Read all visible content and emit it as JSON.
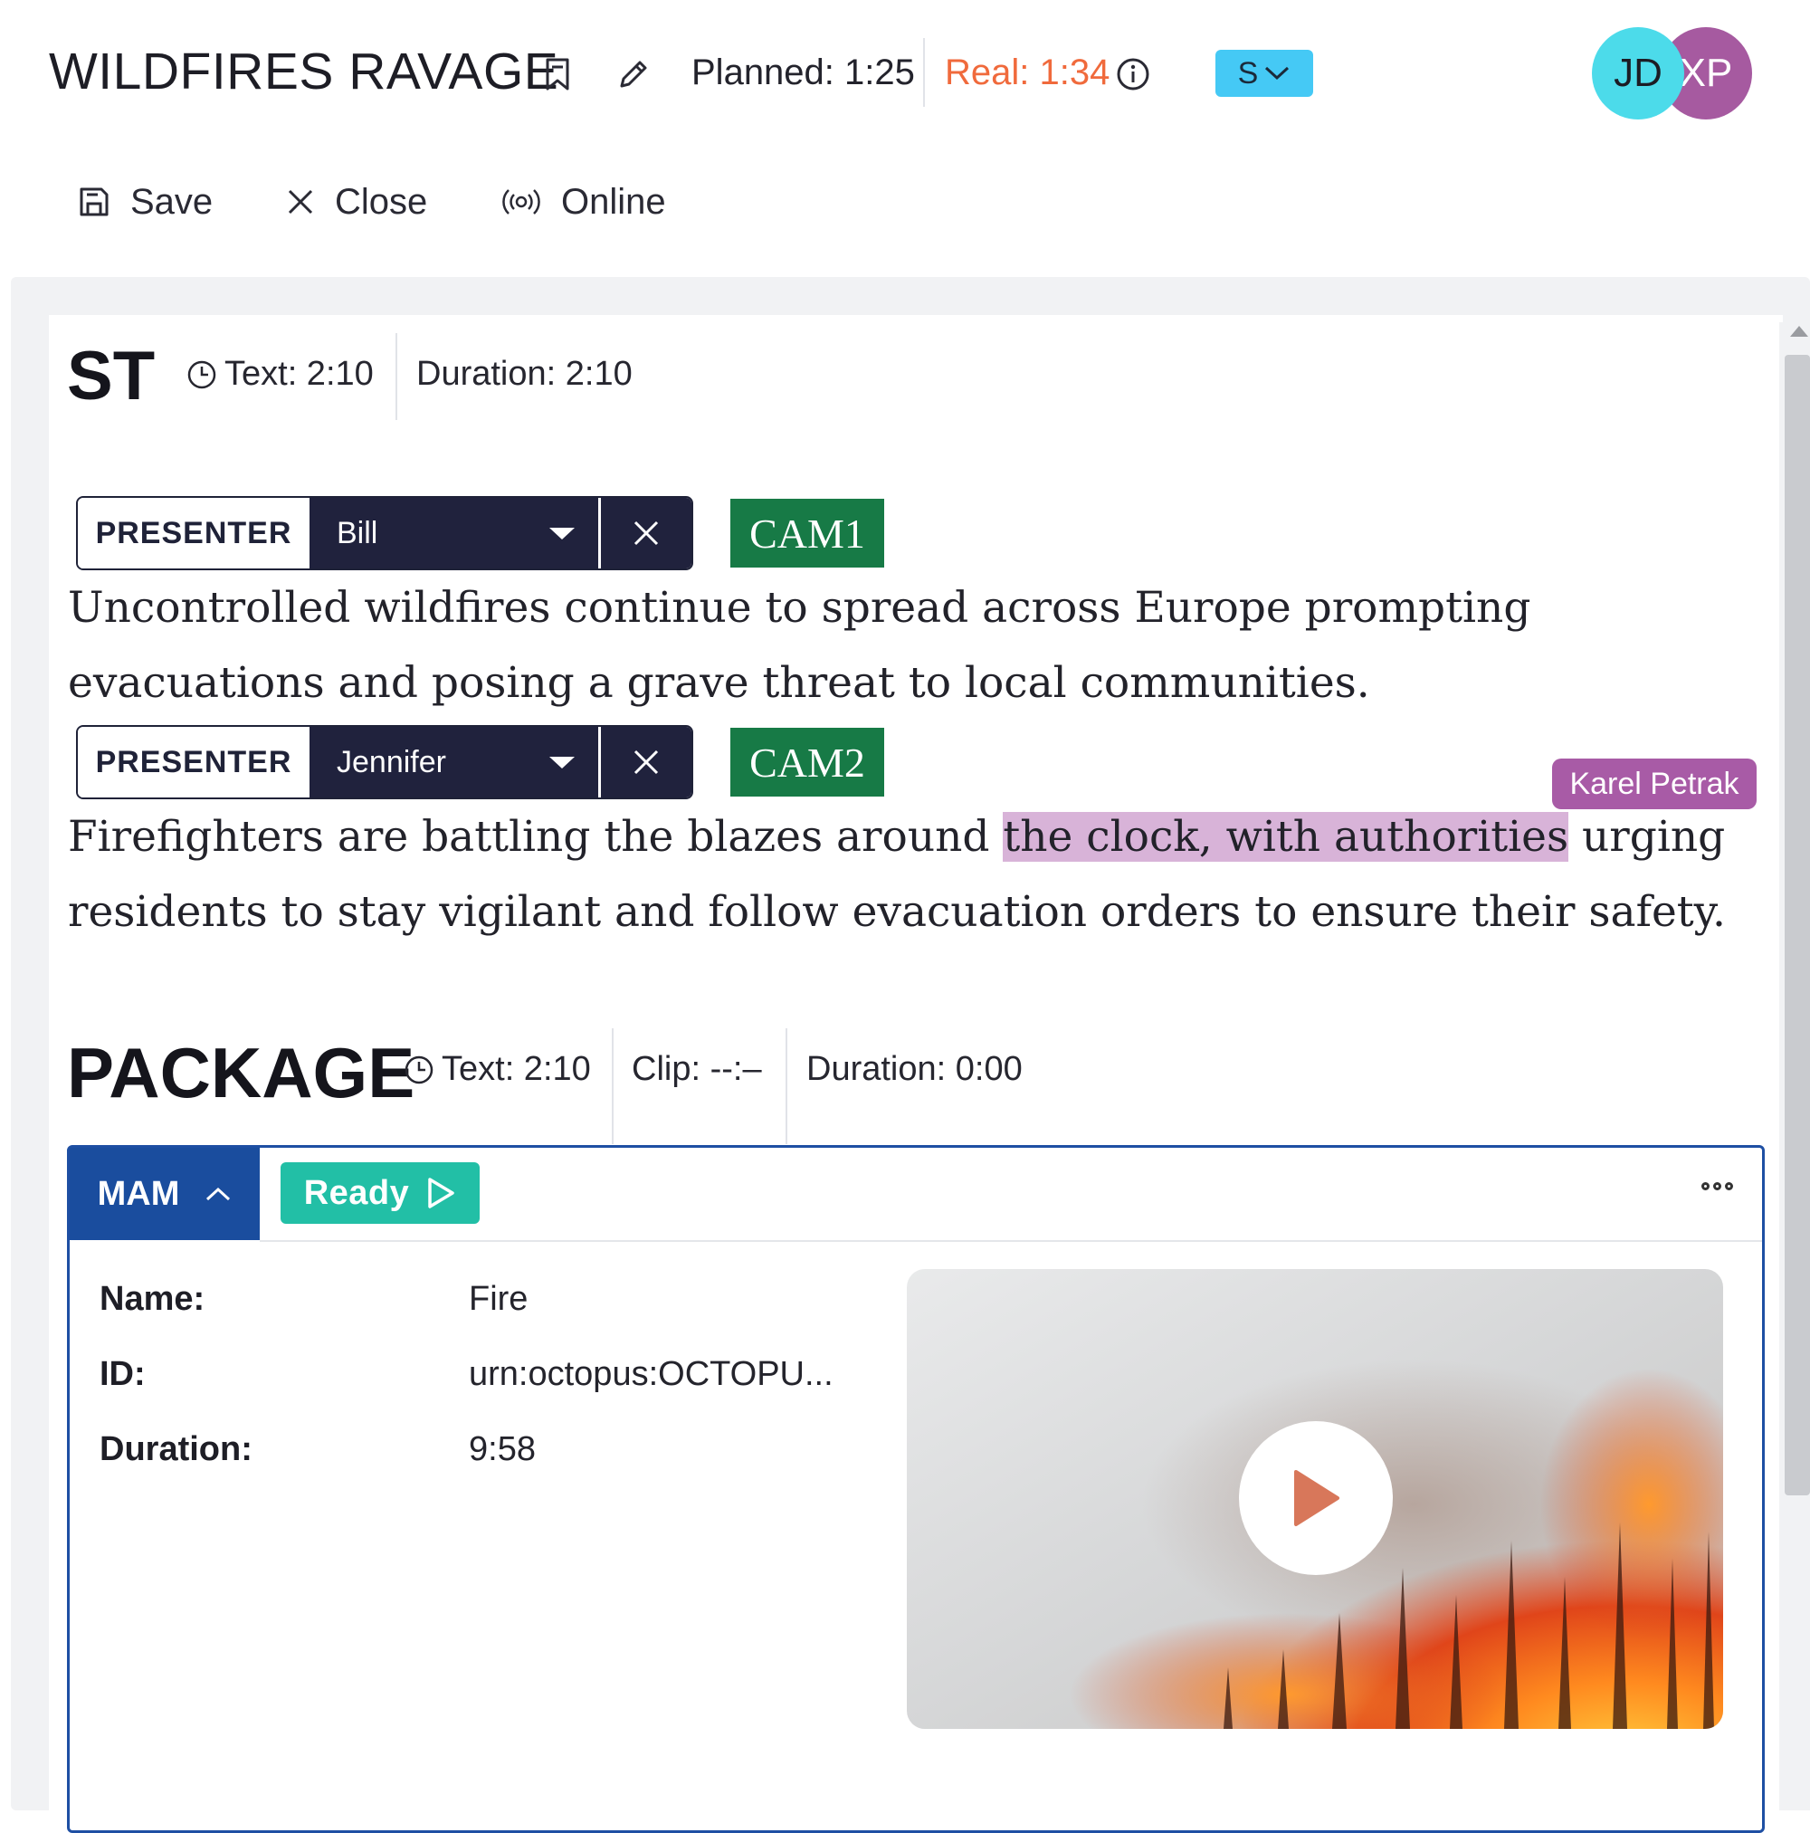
{
  "header": {
    "title": "WILDFIRES RAVAGE",
    "planned": "Planned: 1:25",
    "real": "Real: 1:34",
    "status_dropdown": "S",
    "avatars": [
      {
        "initials": "JD",
        "color": "#4cdbea"
      },
      {
        "initials": "XP",
        "color": "#a65aa0"
      }
    ]
  },
  "toolbar": {
    "save": "Save",
    "close": "Close",
    "online": "Online"
  },
  "st_section": {
    "title": "ST",
    "text_time": "Text: 2:10",
    "duration": "Duration: 2:10",
    "blocks": [
      {
        "role": "PRESENTER",
        "presenter": "Bill",
        "camera": "CAM1",
        "lines": [
          "Uncontrolled wildfires continue to spread across Europe prompting",
          "evacuations and posing a grave threat to local communities."
        ]
      },
      {
        "role": "PRESENTER",
        "presenter": "Jennifer",
        "camera": "CAM2",
        "line1_before": "Firefighters are battling the blazes around ",
        "line1_highlight": "the clock, with authorities",
        "line1_after": " urging",
        "line2": "residents to stay vigilant and follow evacuation orders to ensure their safety.",
        "collaborator": "Karel Petrak"
      }
    ]
  },
  "package_section": {
    "title": "PACKAGE",
    "text_time": "Text: 2:10",
    "clip": "Clip: --:–",
    "duration": "Duration: 0:00"
  },
  "mam": {
    "tab_label": "MAM",
    "status": "Ready",
    "fields": [
      {
        "label": "Name:",
        "value": "Fire"
      },
      {
        "label": "ID:",
        "value": "urn:octopus:OCTOPU..."
      },
      {
        "label": "Duration:",
        "value": "9:58"
      }
    ]
  },
  "colors": {
    "accent_blue": "#1a4d9e",
    "cam_green": "#177a46",
    "ready_teal": "#22bfa6",
    "real_orange": "#f06a3c",
    "highlight": "#d8b3d8",
    "collaborator": "#a85ba6"
  },
  "icons": [
    "bookmark-icon",
    "pencil-icon",
    "info-icon",
    "chevron-down-icon",
    "save-icon",
    "close-icon",
    "broadcast-icon",
    "clock-icon",
    "caret-down-icon",
    "remove-icon",
    "chevron-up-icon",
    "play-outline-icon",
    "more-icon",
    "play-icon"
  ]
}
